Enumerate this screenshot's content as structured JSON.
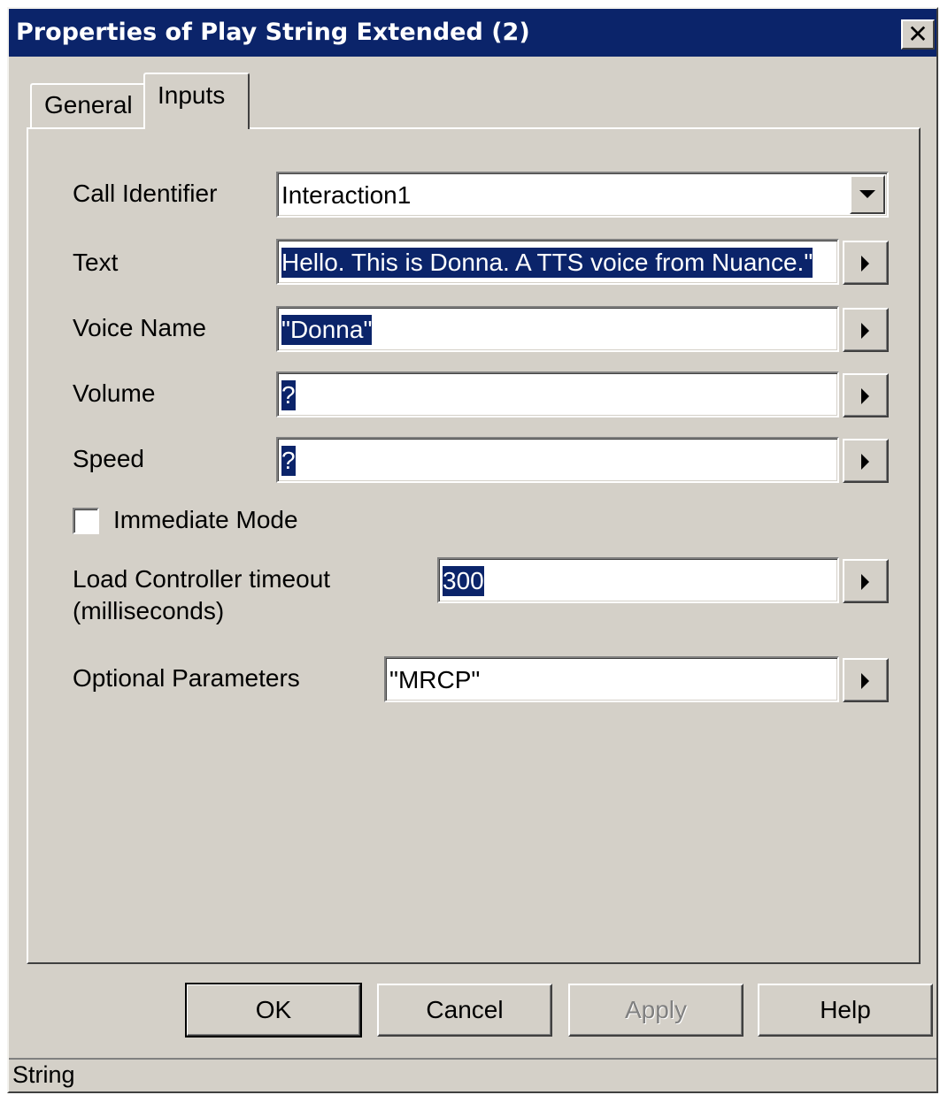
{
  "window": {
    "title": "Properties of Play String Extended (2)",
    "close_glyph": "✕"
  },
  "tabs": [
    {
      "label": "General",
      "active": false
    },
    {
      "label": "Inputs",
      "active": true
    }
  ],
  "form": {
    "call_identifier": {
      "label": "Call Identifier",
      "value": "Interaction1"
    },
    "text": {
      "label": "Text",
      "value": "Hello. This is Donna. A TTS voice from Nuance.\""
    },
    "voice_name": {
      "label": "Voice Name",
      "value": "\"Donna\""
    },
    "volume": {
      "label": "Volume",
      "value": "?"
    },
    "speed": {
      "label": "Speed",
      "value": "?"
    },
    "immediate_mode": {
      "label": "Immediate Mode",
      "checked": false
    },
    "load_controller_timeout": {
      "label_line1": "Load Controller timeout",
      "label_line2": "(milliseconds)",
      "value": "300"
    },
    "optional_parameters": {
      "label": "Optional Parameters",
      "value": "\"MRCP\""
    }
  },
  "buttons": {
    "ok": "OK",
    "cancel": "Cancel",
    "apply": "Apply",
    "help": "Help"
  },
  "status_bar": {
    "text": "String"
  },
  "colors": {
    "title_bar": "#0b246a",
    "face": "#d4d0c8",
    "selection": "#0b246a"
  }
}
